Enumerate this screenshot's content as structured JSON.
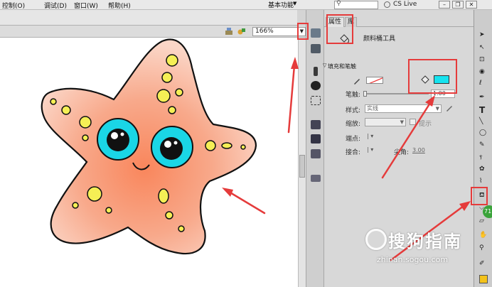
{
  "menu": {
    "items": [
      "控制(O)",
      "调试(D)",
      "窗口(W)",
      "帮助(H)"
    ],
    "workspace": "基本功能",
    "cs_live": "CS Live"
  },
  "stage": {
    "zoom": "166%"
  },
  "properties": {
    "tabs": [
      "属性",
      "库"
    ],
    "tool_name": "颜料桶工具",
    "section": "填充和笔触",
    "stroke_label": "笔触:",
    "stroke_value": "1.00",
    "style_label": "样式:",
    "style_value": "实线",
    "scale_label": "缩放:",
    "hint_label": "提示",
    "cap_label": "端点:",
    "join_label": "接合:",
    "miter_label": "尖角:",
    "miter_value": "3.00"
  },
  "colors": {
    "fill": "#17e3ef",
    "annotation": "#e53b3b",
    "starfish_fill": "#f7a080",
    "eye": "#1ad6e6",
    "spot": "#f5ef55"
  },
  "watermark": {
    "brand": "搜狗指南",
    "url": "zhinan.sogou.com"
  },
  "badge": "71"
}
